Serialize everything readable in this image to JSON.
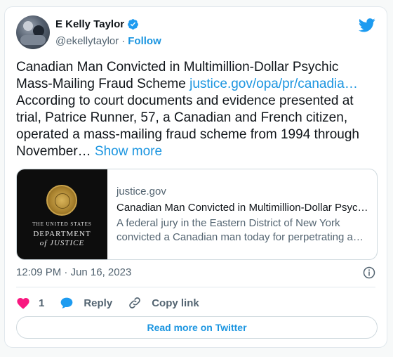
{
  "author": {
    "name": "E Kelly Taylor",
    "handle": "@ekellytaylor",
    "separator": "·",
    "follow_label": "Follow"
  },
  "tweet": {
    "text_main": "Canadian Man Convicted in Multimillion-Dollar Psychic Mass-Mailing Fraud Scheme ",
    "link_text": "justice.gov/opa/pr/canadia…",
    "text_rest": " According to court documents and evidence presented at trial, Patrice Runner, 57, a Canadian and French citizen, operated a mass-mailing fraud scheme from 1994 through November…",
    "show_more": "Show more"
  },
  "link_card": {
    "thumb_line1": "THE UNITED STATES",
    "thumb_line2": "DEPARTMENT",
    "thumb_line3": "of JUSTICE",
    "domain": "justice.gov",
    "title": "Canadian Man Convicted in Multimillion-Dollar Psychic Mass-Mailing Fraud Scheme",
    "description": "A federal jury in the Eastern District of New York convicted a Canadian man today for perpetrating a multimillion-dollar fraud scheme."
  },
  "meta": {
    "time": "12:09 PM",
    "separator": "·",
    "date": "Jun 16, 2023"
  },
  "actions": {
    "like_count": "1",
    "reply_label": "Reply",
    "copy_label": "Copy link"
  },
  "footer": {
    "read_more_label": "Read more on Twitter"
  },
  "colors": {
    "accent": "#1b95e0",
    "like": "#f91880",
    "reply": "#1d9bf0",
    "secondary_text": "#536471"
  }
}
